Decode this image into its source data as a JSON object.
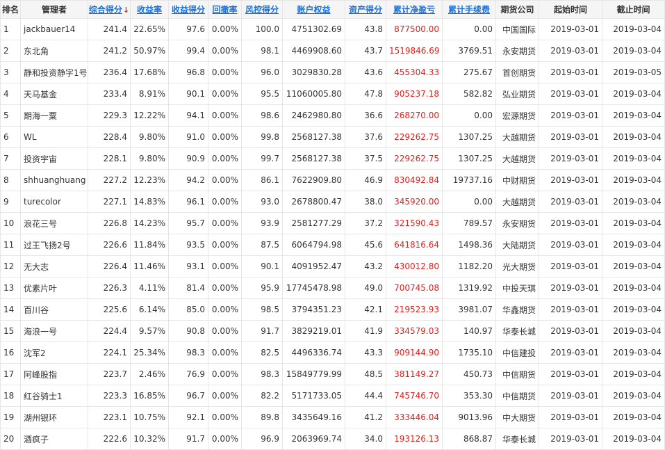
{
  "headers": {
    "rank": "排名",
    "manager": "管理者",
    "total_score": "综合得分",
    "total_score_arrow": "↓",
    "yield_rate": "收益率",
    "yield_score": "收益得分",
    "drawdown": "回撤率",
    "risk_score": "风控得分",
    "equity": "账户权益",
    "asset_score": "资产得分",
    "cum_pnl": "累计净盈亏",
    "cum_fee": "累计手续费",
    "broker": "期货公司",
    "start": "起始时间",
    "end": "截止时间"
  },
  "rows": [
    {
      "rank": "1",
      "manager": "jackbauer14",
      "total": "241.4",
      "yield": "22.65%",
      "yscore": "97.6",
      "dd": "0.00%",
      "risk": "100.0",
      "equity": "4751302.69",
      "ascore": "43.8",
      "pnl": "877500.00",
      "fee": "0.00",
      "broker": "中国国际",
      "start": "2019-03-01",
      "end": "2019-03-04"
    },
    {
      "rank": "2",
      "manager": "东北角",
      "total": "241.2",
      "yield": "50.97%",
      "yscore": "99.4",
      "dd": "0.00%",
      "risk": "98.1",
      "equity": "4469908.60",
      "ascore": "43.7",
      "pnl": "1519846.69",
      "fee": "3769.51",
      "broker": "永安期货",
      "start": "2019-03-01",
      "end": "2019-03-04"
    },
    {
      "rank": "3",
      "manager": "静和投资静字1号",
      "total": "236.4",
      "yield": "17.68%",
      "yscore": "96.8",
      "dd": "0.00%",
      "risk": "96.0",
      "equity": "3029830.28",
      "ascore": "43.6",
      "pnl": "455304.33",
      "fee": "275.67",
      "broker": "首创期货",
      "start": "2019-03-01",
      "end": "2019-03-05"
    },
    {
      "rank": "4",
      "manager": "天马基金",
      "total": "233.4",
      "yield": "8.91%",
      "yscore": "90.1",
      "dd": "0.00%",
      "risk": "95.5",
      "equity": "11060005.80",
      "ascore": "47.8",
      "pnl": "905237.18",
      "fee": "582.82",
      "broker": "弘业期货",
      "start": "2019-03-01",
      "end": "2019-03-04"
    },
    {
      "rank": "5",
      "manager": "期海一粟",
      "total": "229.3",
      "yield": "12.22%",
      "yscore": "94.1",
      "dd": "0.00%",
      "risk": "98.6",
      "equity": "2462980.80",
      "ascore": "36.6",
      "pnl": "268270.00",
      "fee": "0.00",
      "broker": "宏源期货",
      "start": "2019-03-01",
      "end": "2019-03-04"
    },
    {
      "rank": "6",
      "manager": "WL",
      "total": "228.4",
      "yield": "9.80%",
      "yscore": "91.0",
      "dd": "0.00%",
      "risk": "99.8",
      "equity": "2568127.38",
      "ascore": "37.6",
      "pnl": "229262.75",
      "fee": "1307.25",
      "broker": "大越期货",
      "start": "2019-03-01",
      "end": "2019-03-04"
    },
    {
      "rank": "7",
      "manager": "投资宇宙",
      "total": "228.1",
      "yield": "9.80%",
      "yscore": "90.9",
      "dd": "0.00%",
      "risk": "99.7",
      "equity": "2568127.38",
      "ascore": "37.5",
      "pnl": "229262.75",
      "fee": "1307.25",
      "broker": "大越期货",
      "start": "2019-03-01",
      "end": "2019-03-04"
    },
    {
      "rank": "8",
      "manager": "shhuanghuang",
      "total": "227.2",
      "yield": "12.23%",
      "yscore": "94.2",
      "dd": "0.00%",
      "risk": "86.1",
      "equity": "7622909.80",
      "ascore": "46.9",
      "pnl": "830492.84",
      "fee": "19737.16",
      "broker": "中财期货",
      "start": "2019-03-01",
      "end": "2019-03-04"
    },
    {
      "rank": "9",
      "manager": "turecolor",
      "total": "227.1",
      "yield": "14.83%",
      "yscore": "96.1",
      "dd": "0.00%",
      "risk": "93.0",
      "equity": "2678800.47",
      "ascore": "38.0",
      "pnl": "345920.00",
      "fee": "0.00",
      "broker": "大越期货",
      "start": "2019-03-01",
      "end": "2019-03-04"
    },
    {
      "rank": "10",
      "manager": "浪花三号",
      "total": "226.8",
      "yield": "14.23%",
      "yscore": "95.7",
      "dd": "0.00%",
      "risk": "93.9",
      "equity": "2581277.29",
      "ascore": "37.2",
      "pnl": "321590.43",
      "fee": "789.57",
      "broker": "永安期货",
      "start": "2019-03-01",
      "end": "2019-03-04"
    },
    {
      "rank": "11",
      "manager": "过王飞扬2号",
      "total": "226.6",
      "yield": "11.84%",
      "yscore": "93.5",
      "dd": "0.00%",
      "risk": "87.5",
      "equity": "6064794.98",
      "ascore": "45.6",
      "pnl": "641816.64",
      "fee": "1498.36",
      "broker": "大陆期货",
      "start": "2019-03-01",
      "end": "2019-03-04"
    },
    {
      "rank": "12",
      "manager": "无大志",
      "total": "226.4",
      "yield": "11.46%",
      "yscore": "93.1",
      "dd": "0.00%",
      "risk": "90.1",
      "equity": "4091952.47",
      "ascore": "43.2",
      "pnl": "430012.80",
      "fee": "1182.20",
      "broker": "光大期货",
      "start": "2019-03-01",
      "end": "2019-03-04"
    },
    {
      "rank": "13",
      "manager": "优素片叶",
      "total": "226.3",
      "yield": "4.11%",
      "yscore": "81.4",
      "dd": "0.00%",
      "risk": "95.9",
      "equity": "17745478.98",
      "ascore": "49.0",
      "pnl": "700745.08",
      "fee": "1319.92",
      "broker": "中投天琪",
      "start": "2019-03-01",
      "end": "2019-03-04"
    },
    {
      "rank": "14",
      "manager": "百川谷",
      "total": "225.6",
      "yield": "6.14%",
      "yscore": "85.0",
      "dd": "0.00%",
      "risk": "98.5",
      "equity": "3794351.23",
      "ascore": "42.1",
      "pnl": "219523.93",
      "fee": "3981.07",
      "broker": "华鑫期货",
      "start": "2019-03-01",
      "end": "2019-03-04"
    },
    {
      "rank": "15",
      "manager": "海浪一号",
      "total": "224.4",
      "yield": "9.57%",
      "yscore": "90.8",
      "dd": "0.00%",
      "risk": "91.7",
      "equity": "3829219.01",
      "ascore": "41.9",
      "pnl": "334579.03",
      "fee": "140.97",
      "broker": "华泰长城",
      "start": "2019-03-01",
      "end": "2019-03-04"
    },
    {
      "rank": "16",
      "manager": "沈军2",
      "total": "224.1",
      "yield": "25.34%",
      "yscore": "98.3",
      "dd": "0.00%",
      "risk": "82.5",
      "equity": "4496336.74",
      "ascore": "43.3",
      "pnl": "909144.90",
      "fee": "1735.10",
      "broker": "中信建投",
      "start": "2019-03-01",
      "end": "2019-03-04"
    },
    {
      "rank": "17",
      "manager": "阿峰股指",
      "total": "223.7",
      "yield": "2.46%",
      "yscore": "76.9",
      "dd": "0.00%",
      "risk": "98.3",
      "equity": "15849779.99",
      "ascore": "48.5",
      "pnl": "381149.27",
      "fee": "450.73",
      "broker": "中信期货",
      "start": "2019-03-01",
      "end": "2019-03-04"
    },
    {
      "rank": "18",
      "manager": "红谷骑士1",
      "total": "223.3",
      "yield": "16.85%",
      "yscore": "96.7",
      "dd": "0.00%",
      "risk": "82.2",
      "equity": "5171733.05",
      "ascore": "44.4",
      "pnl": "745746.70",
      "fee": "353.30",
      "broker": "中信期货",
      "start": "2019-03-01",
      "end": "2019-03-04"
    },
    {
      "rank": "19",
      "manager": "湖州银环",
      "total": "223.1",
      "yield": "10.75%",
      "yscore": "92.1",
      "dd": "0.00%",
      "risk": "89.8",
      "equity": "3435649.16",
      "ascore": "41.2",
      "pnl": "333446.04",
      "fee": "9013.96",
      "broker": "中大期货",
      "start": "2019-03-01",
      "end": "2019-03-04"
    },
    {
      "rank": "20",
      "manager": "酒疯子",
      "total": "222.6",
      "yield": "10.32%",
      "yscore": "91.7",
      "dd": "0.00%",
      "risk": "96.9",
      "equity": "2063969.74",
      "ascore": "34.0",
      "pnl": "193126.13",
      "fee": "868.87",
      "broker": "华泰长城",
      "start": "2019-03-01",
      "end": "2019-03-04"
    }
  ]
}
